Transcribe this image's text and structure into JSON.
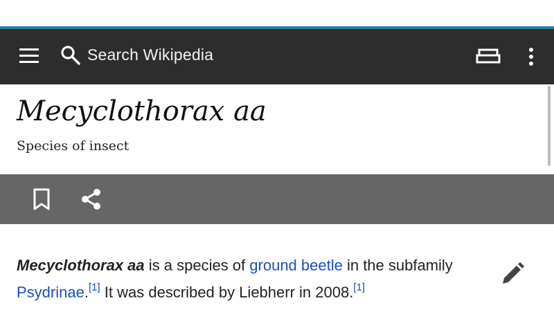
{
  "toolbar": {
    "menu_icon": "hamburger-menu-icon",
    "search_icon": "search-icon",
    "search_placeholder": "Search Wikipedia",
    "tabs_icon": "tabs-icon",
    "overflow_icon": "more-vertical-icon",
    "background": "#2d2d2d",
    "accent": "#2e7d9a"
  },
  "article": {
    "title": "Mecyclothorax aa",
    "description": "Species of insect",
    "body": {
      "subject": "Mecyclothorax aa",
      "text1": " is a species of ",
      "link1": "ground beetle",
      "text2": " in the subfamily ",
      "link2": "Psydrinae",
      "text3": ".",
      "ref1": "[1]",
      "text4": " It was described by Liebherr in 2008.",
      "ref2": "[1]"
    }
  },
  "actions": {
    "bookmark_icon": "bookmark-icon",
    "share_icon": "share-icon",
    "edit_icon": "edit-pencil-icon",
    "background": "#666666"
  },
  "colors": {
    "link": "#1a4fba",
    "text": "#222222"
  }
}
